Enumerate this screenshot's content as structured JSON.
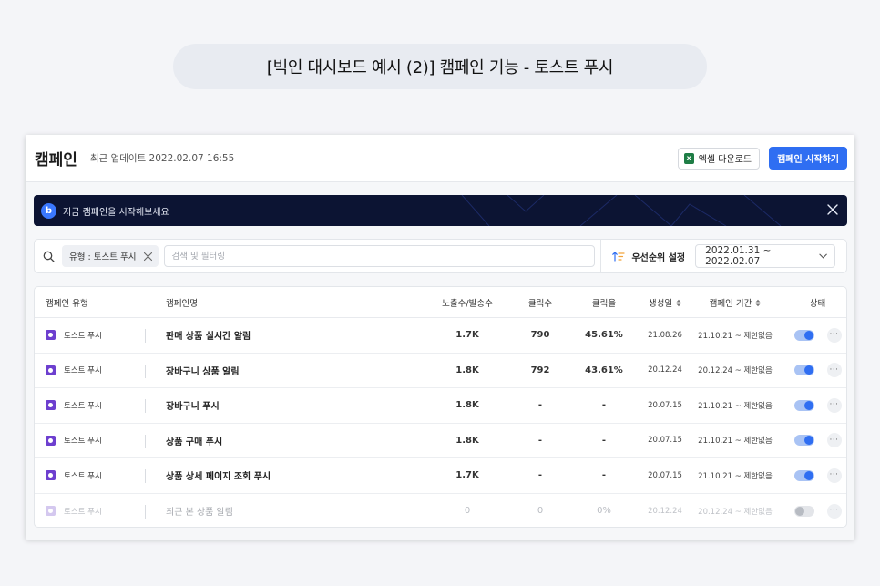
{
  "caption": "[빅인 대시보드 예시 (2)] 캠페인 기능 - 토스트 푸시",
  "header": {
    "title": "캠페인",
    "updated": "최근 업데이트 2022.02.07 16:55",
    "excel_icon_letter": "x",
    "excel_label": "엑셀 다운로드",
    "start_label": "캠페인 시작하기"
  },
  "banner": {
    "logo_letter": "b",
    "text": "지금 캠페인을 시작해보세요"
  },
  "filter": {
    "chip_label": "유형 : 토스트 푸시",
    "search_placeholder": "검색 및 필터링",
    "sort_label": "우선순위 설정",
    "date_range": "2022.01.31 ~ 2022.02.07"
  },
  "table": {
    "columns": {
      "type": "캠페인 유형",
      "name": "캠페인명",
      "impressions": "노출수/발송수",
      "clicks": "클릭수",
      "ctr": "클릭율",
      "created": "생성일",
      "period": "캠페인 기간",
      "status": "상태"
    },
    "more_glyph": "···",
    "rows": [
      {
        "type": "토스트 푸시",
        "name": "판매 상품 실시간 알림",
        "impressions": "1.7K",
        "clicks": "790",
        "ctr": "45.61%",
        "created": "21.08.26",
        "period": "21.10.21 ~ 제한없음",
        "active": true
      },
      {
        "type": "토스트 푸시",
        "name": "장바구니 상품 알림",
        "impressions": "1.8K",
        "clicks": "792",
        "ctr": "43.61%",
        "created": "20.12.24",
        "period": "20.12.24 ~ 제한없음",
        "active": true
      },
      {
        "type": "토스트 푸시",
        "name": "장바구니 푸시",
        "impressions": "1.8K",
        "clicks": "-",
        "ctr": "-",
        "created": "20.07.15",
        "period": "21.10.21 ~ 제한없음",
        "active": true
      },
      {
        "type": "토스트 푸시",
        "name": "상품 구매 푸시",
        "impressions": "1.8K",
        "clicks": "-",
        "ctr": "-",
        "created": "20.07.15",
        "period": "21.10.21 ~ 제한없음",
        "active": true
      },
      {
        "type": "토스트 푸시",
        "name": "상품 상세 페이지 조회 푸시",
        "impressions": "1.7K",
        "clicks": "-",
        "ctr": "-",
        "created": "20.07.15",
        "period": "21.10.21 ~ 제한없음",
        "active": true
      },
      {
        "type": "토스트 푸시",
        "name": "최근 본 상품 알림",
        "impressions": "0",
        "clicks": "0",
        "ctr": "0%",
        "created": "20.12.24",
        "period": "20.12.24 ~ 제한없음",
        "active": false
      }
    ]
  },
  "colors": {
    "accent": "#2f6ef2",
    "banner_bg": "#0c1433",
    "campaign_type_icon": "#6d3fcf"
  }
}
